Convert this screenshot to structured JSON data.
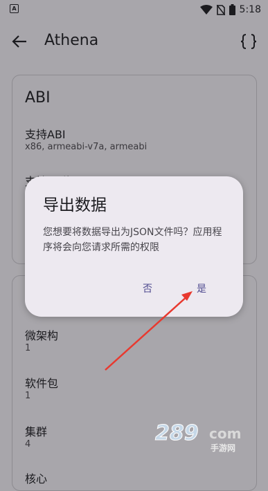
{
  "status_bar": {
    "time": "5:18",
    "app_icon_letter": "A"
  },
  "app_bar": {
    "title": "Athena"
  },
  "abi_card": {
    "heading": "ABI",
    "items": [
      {
        "title": "支持ABI",
        "value": "x86, armeabi-v7a, armeabi"
      },
      {
        "title": "支持64位ABI",
        "value": ""
      }
    ]
  },
  "info_card": {
    "items": [
      {
        "title": "微架构",
        "value": "1"
      },
      {
        "title": "软件包",
        "value": "1"
      },
      {
        "title": "集群",
        "value": "4"
      },
      {
        "title": "核心",
        "value": ""
      }
    ]
  },
  "dialog": {
    "title": "导出数据",
    "message": "您想要将数据导出为JSON文件吗？应用程序将会向您请求所需的权限",
    "cancel_label": "否",
    "confirm_label": "是"
  },
  "watermark": {
    "main": "289",
    "suffix": "com",
    "sub": "手游网"
  },
  "colors": {
    "dialog_bg": "#ede9f0",
    "button_text": "#4f4a8f",
    "arrow": "#e8392f"
  }
}
